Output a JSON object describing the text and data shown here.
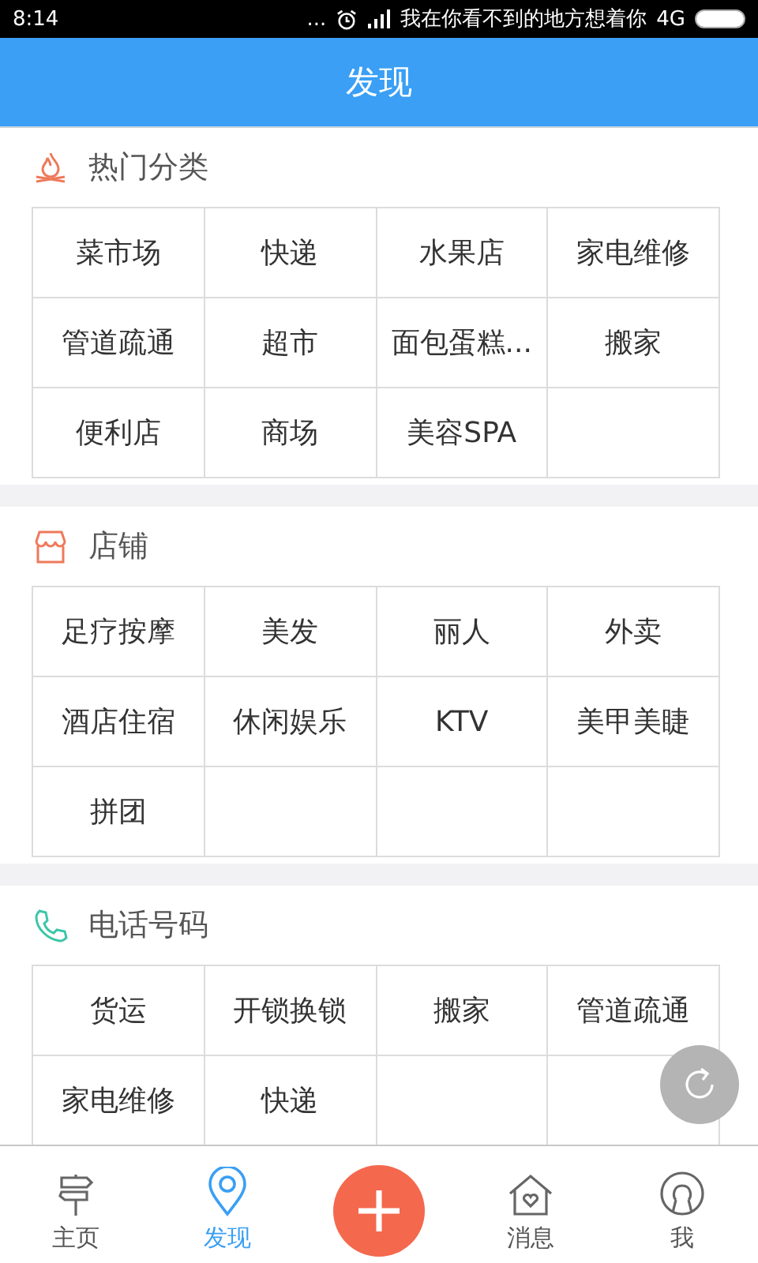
{
  "status_bar": {
    "time": "8:14",
    "dots": "...",
    "carrier": "我在你看不到的地方想着你",
    "network": "4G"
  },
  "header": {
    "title": "发现"
  },
  "sections": [
    {
      "title": "热门分类",
      "kind": "fire",
      "cells": [
        "菜市场",
        "快递",
        "水果店",
        "家电维修",
        "管道疏通",
        "超市",
        "面包蛋糕...",
        "搬家",
        "便利店",
        "商场",
        "美容SPA",
        ""
      ]
    },
    {
      "title": "店铺",
      "kind": "shop",
      "cells": [
        "足疗按摩",
        "美发",
        "丽人",
        "外卖",
        "酒店住宿",
        "休闲娱乐",
        "KTV",
        "美甲美睫",
        "拼团",
        "",
        "",
        ""
      ]
    },
    {
      "title": "电话号码",
      "kind": "phone",
      "cells": [
        "货运",
        "开锁换锁",
        "搬家",
        "管道疏通",
        "家电维修",
        "快递",
        "",
        ""
      ]
    }
  ],
  "tab_bar": [
    {
      "kind": "home",
      "label": "主页",
      "selected": false
    },
    {
      "kind": "discover",
      "label": "发现",
      "selected": true
    },
    {
      "kind": "add"
    },
    {
      "kind": "messages",
      "label": "消息",
      "selected": false
    },
    {
      "kind": "me",
      "label": "我",
      "selected": false
    }
  ]
}
